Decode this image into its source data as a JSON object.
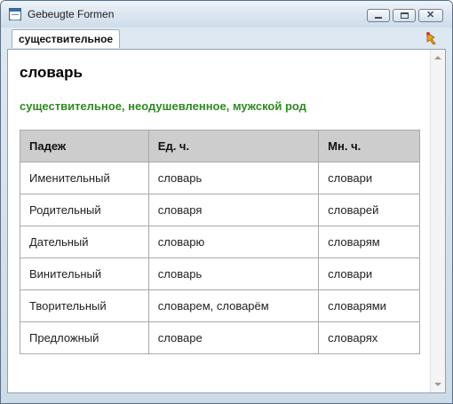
{
  "window": {
    "title": "Gebeugte Formen"
  },
  "icons": {
    "app": "window-app-icon",
    "pin": "pin-icon",
    "minimize": "minimize-icon",
    "maximize": "maximize-icon",
    "close": "close-icon"
  },
  "tab": {
    "label": "существительное"
  },
  "entry": {
    "word": "словарь",
    "grammar": "существительное, неодушевленное, мужской род"
  },
  "table": {
    "headers": [
      "Падеж",
      "Ед. ч.",
      "Мн. ч."
    ],
    "rows": [
      [
        "Именительный",
        "словарь",
        "словари"
      ],
      [
        "Родительный",
        "словаря",
        "словарей"
      ],
      [
        "Дательный",
        "словарю",
        "словарям"
      ],
      [
        "Винительный",
        "словарь",
        "словари"
      ],
      [
        "Творительный",
        "словарем, словарём",
        "словарями"
      ],
      [
        "Предложный",
        "словаре",
        "словарях"
      ]
    ]
  },
  "colors": {
    "grammar_text": "#2f8a22",
    "header_bg": "#cdcdcd",
    "border": "#a9a9a9"
  }
}
